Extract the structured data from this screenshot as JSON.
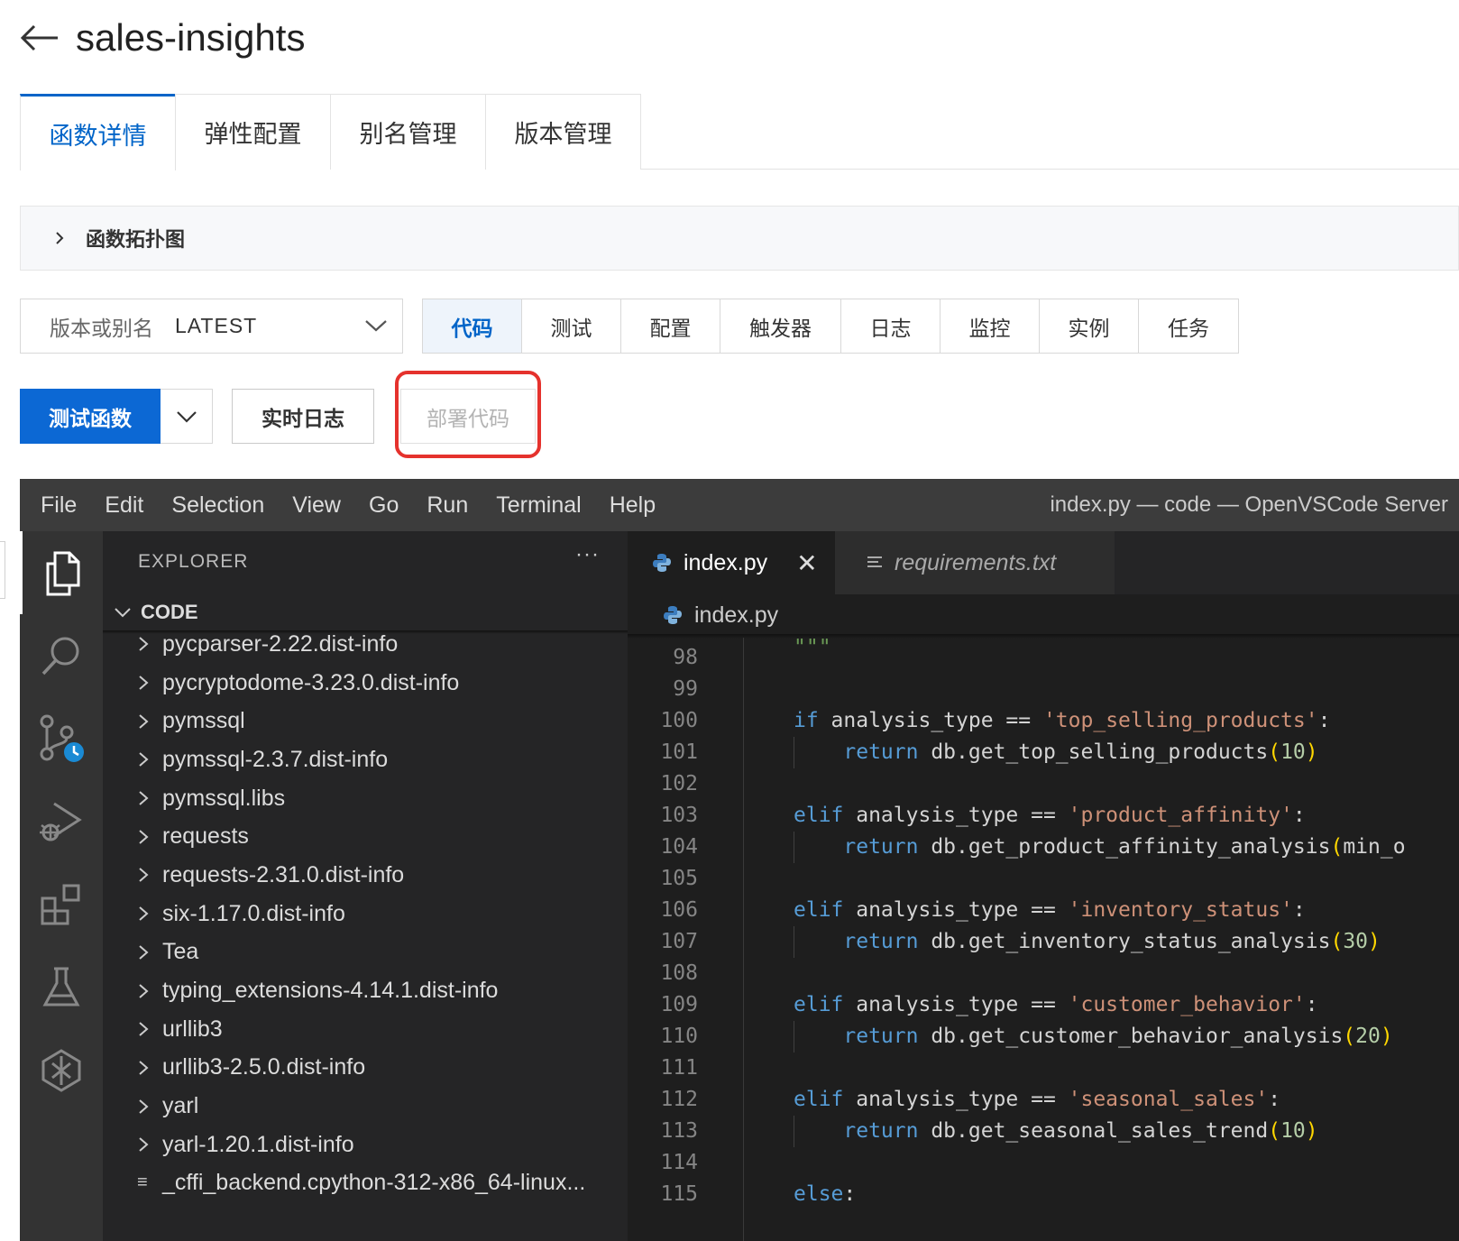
{
  "header": {
    "title": "sales-insights"
  },
  "main_tabs": [
    {
      "label": "函数详情",
      "active": true
    },
    {
      "label": "弹性配置",
      "active": false
    },
    {
      "label": "别名管理",
      "active": false
    },
    {
      "label": "版本管理",
      "active": false
    }
  ],
  "topology": {
    "label": "函数拓扑图"
  },
  "version_select": {
    "label": "版本或别名",
    "value": "LATEST"
  },
  "sub_tabs": [
    {
      "label": "代码",
      "active": true
    },
    {
      "label": "测试",
      "active": false
    },
    {
      "label": "配置",
      "active": false
    },
    {
      "label": "触发器",
      "active": false
    },
    {
      "label": "日志",
      "active": false
    },
    {
      "label": "监控",
      "active": false
    },
    {
      "label": "实例",
      "active": false
    },
    {
      "label": "任务",
      "active": false
    }
  ],
  "actions": {
    "test_label": "测试函数",
    "log_label": "实时日志",
    "deploy_label": "部署代码"
  },
  "colors": {
    "primary": "#0c68d4",
    "highlight": "#e5322d",
    "accent_text": "#0064c8"
  },
  "vscode": {
    "menu": [
      "File",
      "Edit",
      "Selection",
      "View",
      "Go",
      "Run",
      "Terminal",
      "Help"
    ],
    "window_title": "index.py — code — OpenVSCode Server",
    "activity_icons": [
      "explorer-icon",
      "search-icon",
      "source-control-icon",
      "run-debug-icon",
      "extensions-icon",
      "testing-icon",
      "settings-sync-icon"
    ],
    "explorer": {
      "title": "EXPLORER",
      "more": "···",
      "section": "CODE",
      "items": [
        {
          "label": "pycparser-2.22.dist-info",
          "type": "folder"
        },
        {
          "label": "pycryptodome-3.23.0.dist-info",
          "type": "folder"
        },
        {
          "label": "pymssql",
          "type": "folder"
        },
        {
          "label": "pymssql-2.3.7.dist-info",
          "type": "folder"
        },
        {
          "label": "pymssql.libs",
          "type": "folder"
        },
        {
          "label": "requests",
          "type": "folder"
        },
        {
          "label": "requests-2.31.0.dist-info",
          "type": "folder"
        },
        {
          "label": "six-1.17.0.dist-info",
          "type": "folder"
        },
        {
          "label": "Tea",
          "type": "folder"
        },
        {
          "label": "typing_extensions-4.14.1.dist-info",
          "type": "folder"
        },
        {
          "label": "urllib3",
          "type": "folder"
        },
        {
          "label": "urllib3-2.5.0.dist-info",
          "type": "folder"
        },
        {
          "label": "yarl",
          "type": "folder"
        },
        {
          "label": "yarl-1.20.1.dist-info",
          "type": "folder"
        },
        {
          "label": "_cffi_backend.cpython-312-x86_64-linux...",
          "type": "file"
        }
      ]
    },
    "tabs": [
      {
        "label": "index.py",
        "active": true
      },
      {
        "label": "requirements.txt",
        "active": false
      }
    ],
    "breadcrumb": "index.py",
    "code": {
      "docstring_end": "\"\"\"",
      "lines": [
        {
          "n": "98",
          "tokens": []
        },
        {
          "n": "99",
          "tokens": []
        },
        {
          "n": "100",
          "tokens": [
            [
              "kw",
              "if"
            ],
            [
              "ident",
              " analysis_type == "
            ],
            [
              "str",
              "'top_selling_products'"
            ],
            [
              "ident",
              ":"
            ]
          ]
        },
        {
          "n": "101",
          "tokens": [
            [
              "ident",
              "    "
            ],
            [
              "kw",
              "return"
            ],
            [
              "ident",
              " db.get_top_selling_products"
            ],
            [
              "paren",
              "("
            ],
            [
              "num",
              "10"
            ],
            [
              "paren",
              ")"
            ]
          ]
        },
        {
          "n": "102",
          "tokens": []
        },
        {
          "n": "103",
          "tokens": [
            [
              "kw",
              "elif"
            ],
            [
              "ident",
              " analysis_type == "
            ],
            [
              "str",
              "'product_affinity'"
            ],
            [
              "ident",
              ":"
            ]
          ]
        },
        {
          "n": "104",
          "tokens": [
            [
              "ident",
              "    "
            ],
            [
              "kw",
              "return"
            ],
            [
              "ident",
              " db.get_product_affinity_analysis"
            ],
            [
              "paren",
              "("
            ],
            [
              "ident",
              "min_o"
            ]
          ]
        },
        {
          "n": "105",
          "tokens": []
        },
        {
          "n": "106",
          "tokens": [
            [
              "kw",
              "elif"
            ],
            [
              "ident",
              " analysis_type == "
            ],
            [
              "str",
              "'inventory_status'"
            ],
            [
              "ident",
              ":"
            ]
          ]
        },
        {
          "n": "107",
          "tokens": [
            [
              "ident",
              "    "
            ],
            [
              "kw",
              "return"
            ],
            [
              "ident",
              " db.get_inventory_status_analysis"
            ],
            [
              "paren",
              "("
            ],
            [
              "num",
              "30"
            ],
            [
              "paren",
              ")"
            ]
          ]
        },
        {
          "n": "108",
          "tokens": []
        },
        {
          "n": "109",
          "tokens": [
            [
              "kw",
              "elif"
            ],
            [
              "ident",
              " analysis_type == "
            ],
            [
              "str",
              "'customer_behavior'"
            ],
            [
              "ident",
              ":"
            ]
          ]
        },
        {
          "n": "110",
          "tokens": [
            [
              "ident",
              "    "
            ],
            [
              "kw",
              "return"
            ],
            [
              "ident",
              " db.get_customer_behavior_analysis"
            ],
            [
              "paren",
              "("
            ],
            [
              "num",
              "20"
            ],
            [
              "paren",
              ")"
            ]
          ]
        },
        {
          "n": "111",
          "tokens": []
        },
        {
          "n": "112",
          "tokens": [
            [
              "kw",
              "elif"
            ],
            [
              "ident",
              " analysis_type == "
            ],
            [
              "str",
              "'seasonal_sales'"
            ],
            [
              "ident",
              ":"
            ]
          ]
        },
        {
          "n": "113",
          "tokens": [
            [
              "ident",
              "    "
            ],
            [
              "kw",
              "return"
            ],
            [
              "ident",
              " db.get_seasonal_sales_trend"
            ],
            [
              "paren",
              "("
            ],
            [
              "num",
              "10"
            ],
            [
              "paren",
              ")"
            ]
          ]
        },
        {
          "n": "114",
          "tokens": []
        },
        {
          "n": "115",
          "tokens": [
            [
              "kw",
              "else"
            ],
            [
              "ident",
              ":"
            ]
          ]
        }
      ]
    }
  }
}
